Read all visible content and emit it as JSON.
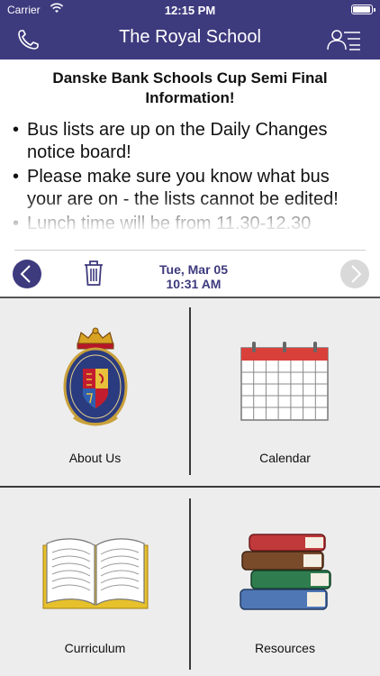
{
  "status_bar": {
    "carrier": "Carrier",
    "time": "12:15 PM",
    "battery_level": 0.95
  },
  "nav": {
    "title": "The Royal School"
  },
  "message": {
    "title": "Danske Bank Schools Cup Semi Final Information!",
    "bullets": [
      "Bus lists are up on the Daily Changes notice board!",
      "Please make sure you know what bus your are on - the lists cannot be edited!",
      "Lunch time will be from 11.30-12.30"
    ]
  },
  "pager": {
    "date": "Tue, Mar 05",
    "time": "10:31 AM"
  },
  "tiles": [
    {
      "label": "About Us",
      "icon": "crest-icon"
    },
    {
      "label": "Calendar",
      "icon": "calendar-icon"
    },
    {
      "label": "Curriculum",
      "icon": "open-book-icon"
    },
    {
      "label": "Resources",
      "icon": "book-stack-icon"
    }
  ],
  "colors": {
    "brand": "#3e3a7e",
    "grid_bg": "#ededed"
  }
}
